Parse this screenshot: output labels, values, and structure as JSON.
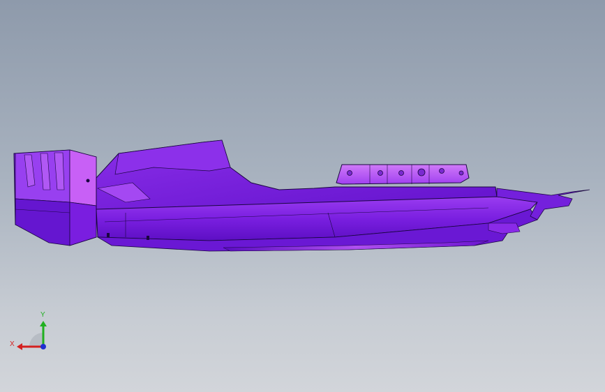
{
  "viewport": {
    "background_top": "#8e9aab",
    "background_bottom": "#d2d5da"
  },
  "model": {
    "part_color": "#7a1fe0",
    "highlight_color": "#c25cf5",
    "shadow_color": "#4a0aa8",
    "edge_color": "#1a0640"
  },
  "triad": {
    "x_label": "X",
    "y_label": "Y",
    "x_color": "#d42020",
    "y_color": "#20b020",
    "z_color": "#2030d0"
  }
}
